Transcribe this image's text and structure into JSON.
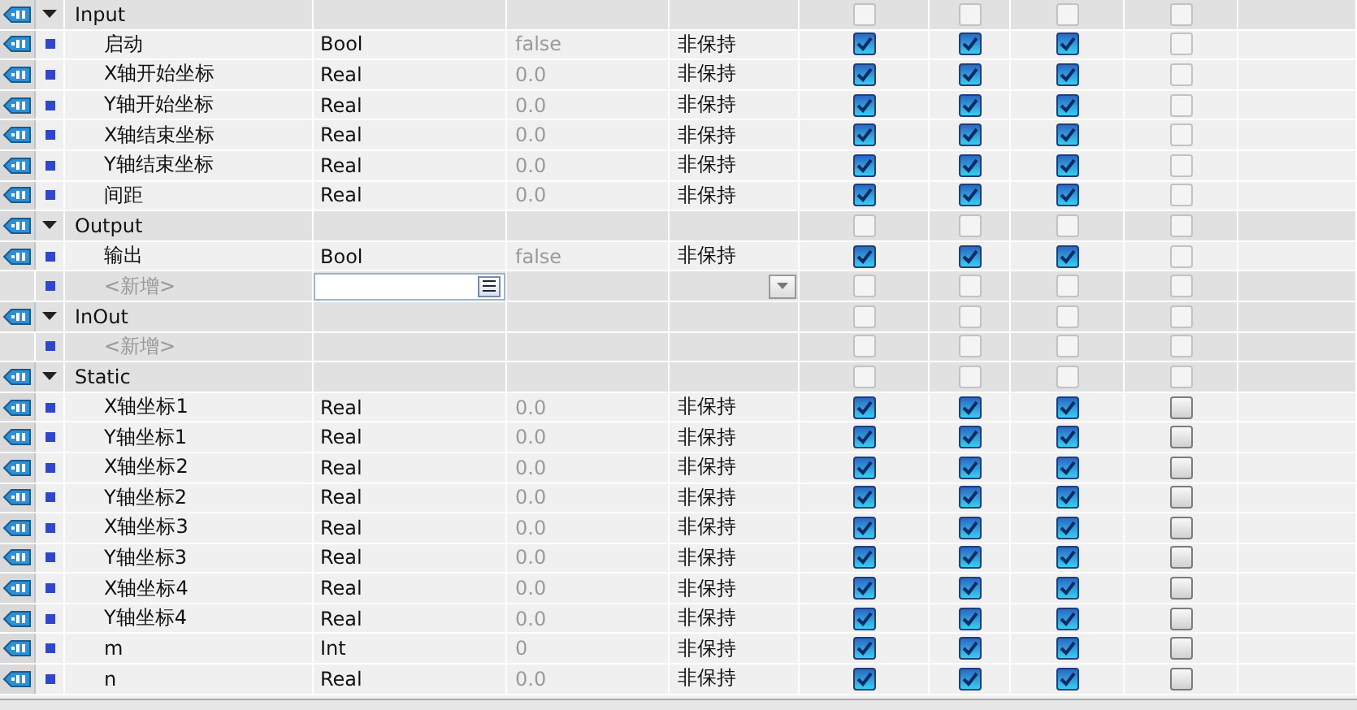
{
  "sections": [
    {
      "name": "Input",
      "expanded": true,
      "checkboxes": [
        {
          "checked": false,
          "disabled": true
        },
        {
          "checked": false,
          "disabled": true
        },
        {
          "checked": false,
          "disabled": true
        },
        {
          "checked": false,
          "disabled": true
        }
      ],
      "children": [
        {
          "kind": "var",
          "name": "启动",
          "data_type": "Bool",
          "default": "false",
          "retain": "非保持",
          "checkboxes": [
            {
              "checked": true,
              "disabled": false
            },
            {
              "checked": true,
              "disabled": false
            },
            {
              "checked": true,
              "disabled": false
            },
            {
              "checked": false,
              "disabled": true
            }
          ]
        },
        {
          "kind": "var",
          "name": "X轴开始坐标",
          "data_type": "Real",
          "default": "0.0",
          "retain": "非保持",
          "checkboxes": [
            {
              "checked": true,
              "disabled": false
            },
            {
              "checked": true,
              "disabled": false
            },
            {
              "checked": true,
              "disabled": false
            },
            {
              "checked": false,
              "disabled": true
            }
          ]
        },
        {
          "kind": "var",
          "name": "Y轴开始坐标",
          "data_type": "Real",
          "default": "0.0",
          "retain": "非保持",
          "checkboxes": [
            {
              "checked": true,
              "disabled": false
            },
            {
              "checked": true,
              "disabled": false
            },
            {
              "checked": true,
              "disabled": false
            },
            {
              "checked": false,
              "disabled": true
            }
          ]
        },
        {
          "kind": "var",
          "name": "X轴结束坐标",
          "data_type": "Real",
          "default": "0.0",
          "retain": "非保持",
          "checkboxes": [
            {
              "checked": true,
              "disabled": false
            },
            {
              "checked": true,
              "disabled": false
            },
            {
              "checked": true,
              "disabled": false
            },
            {
              "checked": false,
              "disabled": true
            }
          ]
        },
        {
          "kind": "var",
          "name": "Y轴结束坐标",
          "data_type": "Real",
          "default": "0.0",
          "retain": "非保持",
          "checkboxes": [
            {
              "checked": true,
              "disabled": false
            },
            {
              "checked": true,
              "disabled": false
            },
            {
              "checked": true,
              "disabled": false
            },
            {
              "checked": false,
              "disabled": true
            }
          ]
        },
        {
          "kind": "var",
          "name": "间距",
          "data_type": "Real",
          "default": "0.0",
          "retain": "非保持",
          "checkboxes": [
            {
              "checked": true,
              "disabled": false
            },
            {
              "checked": true,
              "disabled": false
            },
            {
              "checked": true,
              "disabled": false
            },
            {
              "checked": false,
              "disabled": true
            }
          ]
        }
      ]
    },
    {
      "name": "Output",
      "expanded": true,
      "checkboxes": [
        {
          "checked": false,
          "disabled": true
        },
        {
          "checked": false,
          "disabled": true
        },
        {
          "checked": false,
          "disabled": true
        },
        {
          "checked": false,
          "disabled": true
        }
      ],
      "children": [
        {
          "kind": "var",
          "name": "输出",
          "data_type": "Bool",
          "default": "false",
          "retain": "非保持",
          "checkboxes": [
            {
              "checked": true,
              "disabled": false
            },
            {
              "checked": true,
              "disabled": false
            },
            {
              "checked": true,
              "disabled": false
            },
            {
              "checked": false,
              "disabled": true
            }
          ]
        },
        {
          "kind": "add",
          "placeholder": "<新增>",
          "editing": true,
          "checkboxes": [
            {
              "checked": false,
              "disabled": true
            },
            {
              "checked": false,
              "disabled": true
            },
            {
              "checked": false,
              "disabled": true
            },
            {
              "checked": false,
              "disabled": true
            }
          ]
        }
      ]
    },
    {
      "name": "InOut",
      "expanded": true,
      "checkboxes": [
        {
          "checked": false,
          "disabled": true
        },
        {
          "checked": false,
          "disabled": true
        },
        {
          "checked": false,
          "disabled": true
        },
        {
          "checked": false,
          "disabled": true
        }
      ],
      "children": [
        {
          "kind": "add",
          "placeholder": "<新增>",
          "editing": false,
          "checkboxes": [
            {
              "checked": false,
              "disabled": true
            },
            {
              "checked": false,
              "disabled": true
            },
            {
              "checked": false,
              "disabled": true
            },
            {
              "checked": false,
              "disabled": true
            }
          ]
        }
      ]
    },
    {
      "name": "Static",
      "expanded": true,
      "checkboxes": [
        {
          "checked": false,
          "disabled": true
        },
        {
          "checked": false,
          "disabled": true
        },
        {
          "checked": false,
          "disabled": true
        },
        {
          "checked": false,
          "disabled": true
        }
      ],
      "children": [
        {
          "kind": "var",
          "name": "X轴坐标1",
          "data_type": "Real",
          "default": "0.0",
          "retain": "非保持",
          "checkboxes": [
            {
              "checked": true,
              "disabled": false
            },
            {
              "checked": true,
              "disabled": false
            },
            {
              "checked": true,
              "disabled": false
            },
            {
              "checked": false,
              "disabled": false
            }
          ]
        },
        {
          "kind": "var",
          "name": "Y轴坐标1",
          "data_type": "Real",
          "default": "0.0",
          "retain": "非保持",
          "checkboxes": [
            {
              "checked": true,
              "disabled": false
            },
            {
              "checked": true,
              "disabled": false
            },
            {
              "checked": true,
              "disabled": false
            },
            {
              "checked": false,
              "disabled": false
            }
          ]
        },
        {
          "kind": "var",
          "name": "X轴坐标2",
          "data_type": "Real",
          "default": "0.0",
          "retain": "非保持",
          "checkboxes": [
            {
              "checked": true,
              "disabled": false
            },
            {
              "checked": true,
              "disabled": false
            },
            {
              "checked": true,
              "disabled": false
            },
            {
              "checked": false,
              "disabled": false
            }
          ]
        },
        {
          "kind": "var",
          "name": "Y轴坐标2",
          "data_type": "Real",
          "default": "0.0",
          "retain": "非保持",
          "checkboxes": [
            {
              "checked": true,
              "disabled": false
            },
            {
              "checked": true,
              "disabled": false
            },
            {
              "checked": true,
              "disabled": false
            },
            {
              "checked": false,
              "disabled": false
            }
          ]
        },
        {
          "kind": "var",
          "name": "X轴坐标3",
          "data_type": "Real",
          "default": "0.0",
          "retain": "非保持",
          "checkboxes": [
            {
              "checked": true,
              "disabled": false
            },
            {
              "checked": true,
              "disabled": false
            },
            {
              "checked": true,
              "disabled": false
            },
            {
              "checked": false,
              "disabled": false
            }
          ]
        },
        {
          "kind": "var",
          "name": "Y轴坐标3",
          "data_type": "Real",
          "default": "0.0",
          "retain": "非保持",
          "checkboxes": [
            {
              "checked": true,
              "disabled": false
            },
            {
              "checked": true,
              "disabled": false
            },
            {
              "checked": true,
              "disabled": false
            },
            {
              "checked": false,
              "disabled": false
            }
          ]
        },
        {
          "kind": "var",
          "name": "X轴坐标4",
          "data_type": "Real",
          "default": "0.0",
          "retain": "非保持",
          "checkboxes": [
            {
              "checked": true,
              "disabled": false
            },
            {
              "checked": true,
              "disabled": false
            },
            {
              "checked": true,
              "disabled": false
            },
            {
              "checked": false,
              "disabled": false
            }
          ]
        },
        {
          "kind": "var",
          "name": "Y轴坐标4",
          "data_type": "Real",
          "default": "0.0",
          "retain": "非保持",
          "checkboxes": [
            {
              "checked": true,
              "disabled": false
            },
            {
              "checked": true,
              "disabled": false
            },
            {
              "checked": true,
              "disabled": false
            },
            {
              "checked": false,
              "disabled": false
            }
          ]
        },
        {
          "kind": "var",
          "name": "m",
          "data_type": "Int",
          "default": "0",
          "retain": "非保持",
          "checkboxes": [
            {
              "checked": true,
              "disabled": false
            },
            {
              "checked": true,
              "disabled": false
            },
            {
              "checked": true,
              "disabled": false
            },
            {
              "checked": false,
              "disabled": false
            }
          ]
        },
        {
          "kind": "var",
          "name": "n",
          "data_type": "Real",
          "default": "0.0",
          "retain": "非保持",
          "checkboxes": [
            {
              "checked": true,
              "disabled": false
            },
            {
              "checked": true,
              "disabled": false
            },
            {
              "checked": true,
              "disabled": false
            },
            {
              "checked": false,
              "disabled": false
            }
          ]
        }
      ]
    }
  ]
}
